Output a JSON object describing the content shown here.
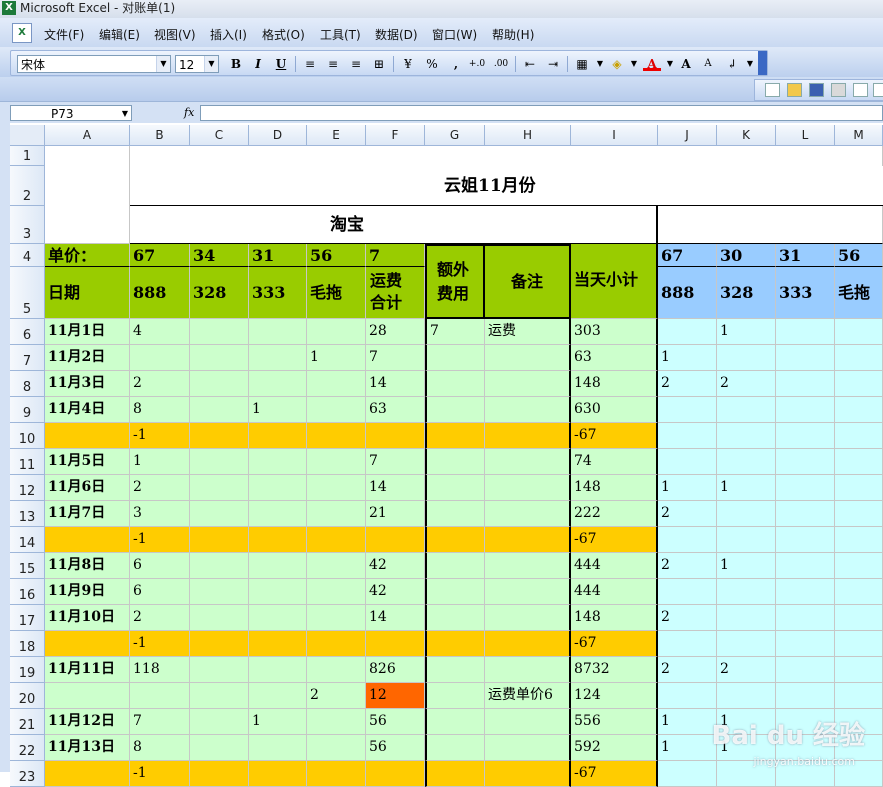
{
  "window": {
    "title": "Microsoft Excel - 对账单(1)"
  },
  "menu": [
    "文件(F)",
    "编辑(E)",
    "视图(V)",
    "插入(I)",
    "格式(O)",
    "工具(T)",
    "数据(D)",
    "窗口(W)",
    "帮助(H)"
  ],
  "toolbar": {
    "font_name": "宋体",
    "font_size": "12",
    "bold": "B",
    "italic": "I",
    "underline": "U",
    "percent": "%",
    "comma": ",",
    "inc_decimal": "+.0",
    "dec_decimal": ".00",
    "font_color_label": "A",
    "grow_font": "A",
    "shrink_font": "A"
  },
  "formula_bar": {
    "name_box": "P73",
    "fx": "fx",
    "content": ""
  },
  "columns": [
    "A",
    "B",
    "C",
    "D",
    "E",
    "F",
    "G",
    "H",
    "I",
    "J",
    "K",
    "L",
    "M"
  ],
  "rows": [
    "1",
    "2",
    "3",
    "4",
    "5",
    "6",
    "7",
    "8",
    "9",
    "10",
    "11",
    "12",
    "13",
    "14",
    "15",
    "16",
    "17",
    "18",
    "19",
    "20",
    "21",
    "22",
    "23"
  ],
  "sheet": {
    "title": "云姐11月份",
    "taobao": "淘宝",
    "unit_label": "单价：",
    "prices_B_F": [
      "67",
      "34",
      "31",
      "56",
      "7"
    ],
    "extra_fee": "额外费用",
    "remark": "备注",
    "daily_subtotal": "当天小计",
    "prices_J_M": [
      "67",
      "30",
      "31",
      "56"
    ],
    "date_header": "日期",
    "items_B_E": [
      "888",
      "328",
      "333",
      "毛拖"
    ],
    "shipping_total": "运费合计",
    "items_J_M": [
      "888",
      "328",
      "333",
      "毛拖"
    ],
    "data": [
      {
        "A": "11月1日",
        "B": "4",
        "F": "28",
        "G": "7",
        "H": "运费",
        "I": "303",
        "K": "1"
      },
      {
        "A": "11月2日",
        "E": "1",
        "F": "7",
        "I": "63",
        "J": "1"
      },
      {
        "A": "11月3日",
        "B": "2",
        "F": "14",
        "I": "148",
        "J": "2",
        "K": "2"
      },
      {
        "A": "11月4日",
        "B": "8",
        "D": "1",
        "F": "63",
        "I": "630"
      },
      {
        "B": "-1",
        "I": "-67",
        "orange": true
      },
      {
        "A": "11月5日",
        "B": "1",
        "F": "7",
        "I": "74"
      },
      {
        "A": "11月6日",
        "B": "2",
        "F": "14",
        "I": "148",
        "J": "1",
        "K": "1"
      },
      {
        "A": "11月7日",
        "B": "3",
        "F": "21",
        "I": "222",
        "J": "2"
      },
      {
        "B": "-1",
        "I": "-67",
        "orange": true
      },
      {
        "A": "11月8日",
        "B": "6",
        "F": "42",
        "I": "444",
        "J": "2",
        "K": "1"
      },
      {
        "A": "11月9日",
        "B": "6",
        "F": "42",
        "I": "444"
      },
      {
        "A": "11月10日",
        "B": "2",
        "F": "14",
        "I": "148",
        "J": "2"
      },
      {
        "B": "-1",
        "I": "-67",
        "orange": true
      },
      {
        "A": "11月11日",
        "B": "118",
        "F": "826",
        "I": "8732",
        "J": "2",
        "K": "2"
      },
      {
        "E": "2",
        "F": "12",
        "H": "运费单价6",
        "I": "124",
        "redF": true
      },
      {
        "A": "11月12日",
        "B": "7",
        "D": "1",
        "F": "56",
        "I": "556",
        "J": "1",
        "K": "1"
      },
      {
        "A": "11月13日",
        "B": "8",
        "F": "56",
        "I": "592",
        "J": "1",
        "K": "1"
      },
      {
        "B": "-1",
        "I": "-67",
        "orange": true
      }
    ]
  },
  "watermark": {
    "main": "Bai du 经验",
    "sub": "jingyan.baidu.com"
  }
}
